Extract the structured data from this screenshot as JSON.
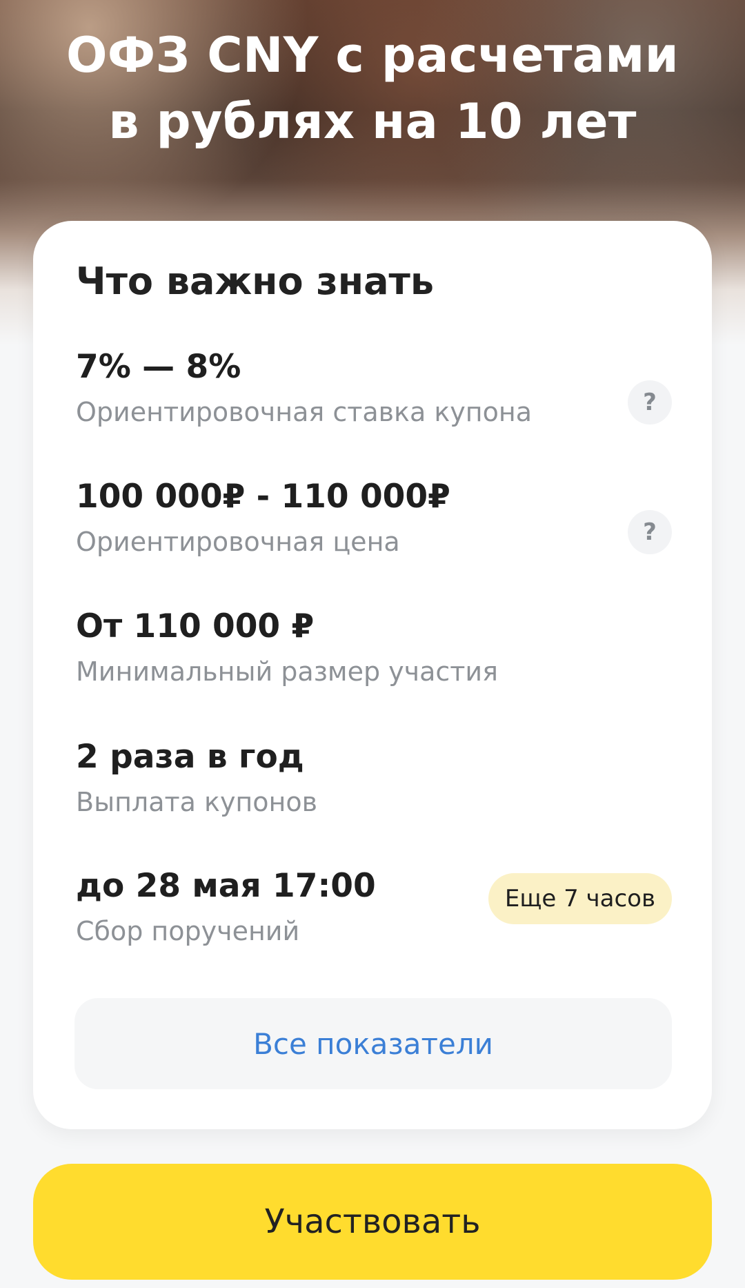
{
  "hero": {
    "title_line1": "ОФЗ CNY с расчетами",
    "title_line2": "в рублях на 10 лет"
  },
  "card": {
    "heading": "Что важно знать",
    "items": [
      {
        "value": "7% — 8%",
        "label": "Ориентировочная ставка купона",
        "help_icon": "question-mark",
        "help_glyph": "?"
      },
      {
        "value": "100 000₽ - 110 000₽",
        "label": "Ориентировочная цена",
        "help_icon": "question-mark",
        "help_glyph": "?"
      },
      {
        "value": "От 110 000 ₽",
        "label": "Минимальный размер участия"
      },
      {
        "value": "2 раза в год",
        "label": "Выплата купонов"
      },
      {
        "value": "до 28 мая 17:00",
        "label": "Сбор поручений",
        "badge": "Еще 7 часов"
      }
    ],
    "all_button": "Все показатели"
  },
  "cta": {
    "label": "Участвовать"
  },
  "colors": {
    "accent_yellow": "#ffdc2e",
    "badge_yellow": "#fbf1c6",
    "link_blue": "#3b7fd6",
    "muted_text": "#8d9196"
  }
}
